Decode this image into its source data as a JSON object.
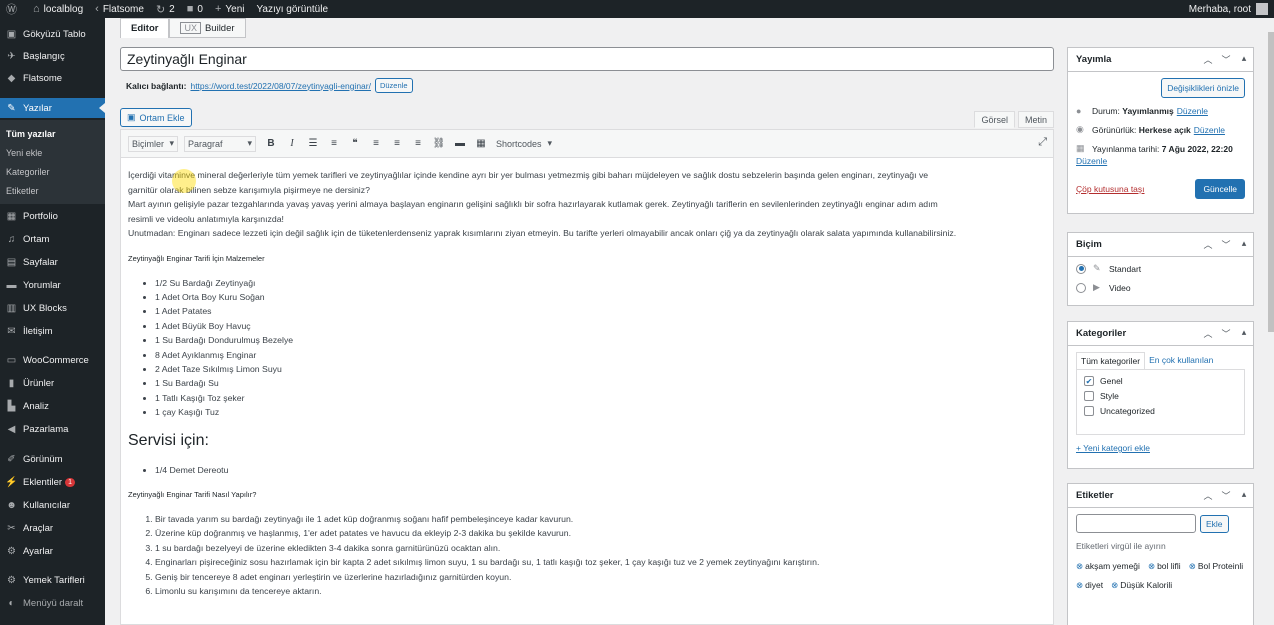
{
  "adminbar": {
    "site": "localblog",
    "theme": "Flatsome",
    "updates": "2",
    "comments": "0",
    "new_label": "Yeni",
    "view_post": "Yazıyı görüntüle",
    "greeting": "Merhaba, root"
  },
  "menu": {
    "items": [
      {
        "label": "Gökyüzü Tablo",
        "icon": "dashboard-icon"
      },
      {
        "label": "Başlangıç",
        "icon": "rocket-icon"
      },
      {
        "label": "Flatsome",
        "icon": "flatsome-icon"
      },
      {
        "label": "Yazılar",
        "icon": "pin-icon"
      },
      {
        "label": "Portfolio",
        "icon": "portfolio-icon"
      },
      {
        "label": "Ortam",
        "icon": "media-icon"
      },
      {
        "label": "Sayfalar",
        "icon": "pages-icon"
      },
      {
        "label": "Yorumlar",
        "icon": "comments-icon"
      },
      {
        "label": "UX Blocks",
        "icon": "blocks-icon"
      },
      {
        "label": "İletişim",
        "icon": "mail-icon"
      },
      {
        "label": "WooCommerce",
        "icon": "woo-icon"
      },
      {
        "label": "Ürünler",
        "icon": "products-icon"
      },
      {
        "label": "Analiz",
        "icon": "chart-icon"
      },
      {
        "label": "Pazarlama",
        "icon": "megaphone-icon"
      },
      {
        "label": "Görünüm",
        "icon": "brush-icon"
      },
      {
        "label": "Eklentiler",
        "icon": "plugin-icon"
      },
      {
        "label": "Kullanıcılar",
        "icon": "users-icon"
      },
      {
        "label": "Araçlar",
        "icon": "tools-icon"
      },
      {
        "label": "Ayarlar",
        "icon": "settings-icon"
      },
      {
        "label": "Yemek Tarifleri",
        "icon": "gear-icon"
      },
      {
        "label": "Menüyü daralt",
        "icon": "collapse-icon"
      }
    ],
    "submenu": [
      "Tüm yazılar",
      "Yeni ekle",
      "Kategoriler",
      "Etiketler"
    ],
    "plugins_badge": "1"
  },
  "editor": {
    "tab_editor": "Editor",
    "tab_ux": "UX",
    "tab_builder": "Builder",
    "title": "Zeytinyağlı Enginar",
    "permalink_label": "Kalıcı bağlantı:",
    "permalink_url": "https://word.test/2022/08/07/zeytinyagli-enginar/",
    "edit_label": "Düzenle",
    "media_button": "Ortam Ekle",
    "visual_tab": "Görsel",
    "text_tab": "Metin",
    "formats": "Biçimler",
    "paragraph": "Paragraf",
    "shortcodes": "Shortcodes"
  },
  "content": {
    "p1_line1": "İçerdiği vitaminve mineral değerleriyle tüm yemek tarifleri ve zeytinyağlılar içinde kendine ayrı bir yer bulması yetmezmiş gibi baharı müjdeleyen ve sağlık dostu sebzelerin başında gelen enginarı, zeytinyağı ve",
    "p1_line2": "garnitür olarak bilinen sebze karışımıyla pişirmeye ne dersiniz?",
    "p2_line1": "Mart ayının gelişiyle pazar tezgahlarında yavaş yavaş yerini almaya başlayan enginarın gelişini sağlıklı bir sofra hazırlayarak kutlamak gerek. Zeytinyağlı tariflerin en sevilenlerinden zeytinyağlı enginar adım adım",
    "p2_line2": "resimli ve videolu anlatımıyla karşınızda!",
    "p3": "Unutmadan: Enginarı sadece lezzeti için değil sağlık için de tüketenlerdenseniz yaprak kısımlarını ziyan etmeyin. Bu tarifte yerleri olmayabilir ancak onları çiğ ya da zeytinyağlı olarak salata yapımında kullanabilirsiniz.",
    "ingredients_heading": "Zeytinyağlı Enginar Tarifi İçin Malzemeler",
    "ingredients": [
      "1/2 Su Bardağı Zeytinyağı",
      "1 Adet Orta Boy Kuru Soğan",
      "1 Adet Patates",
      "1 Adet Büyük Boy Havuç",
      "1 Su Bardağı Dondurulmuş Bezelye",
      "8 Adet Ayıklanmış Enginar",
      "2 Adet Taze Sıkılmış Limon Suyu",
      "1 Su Bardağı Su",
      "1 Tatlı Kaşığı Toz şeker",
      "1 çay Kaşığı Tuz"
    ],
    "serving_heading": "Servisi için:",
    "serving": [
      "1/4 Demet Dereotu"
    ],
    "steps_heading": "Zeytinyağlı Enginar Tarifi Nasıl Yapılır?",
    "steps": [
      "Bir tavada yarım su bardağı zeytinyağı ile 1 adet küp doğranmış soğanı hafif pembeleşinceye kadar kavurun.",
      "Üzerine küp doğranmış ve haşlanmış, 1'er adet patates ve havucu da ekleyip 2-3 dakika bu şekilde kavurun.",
      "1 su bardağı bezelyeyi de üzerine ekledikten 3-4 dakika sonra garnitürünüzü ocaktan alın.",
      "Enginarları pişireceğiniz sosu hazırlamak için bir kapta 2 adet sıkılmış limon suyu, 1 su bardağı su,  1 tatlı kaşığı toz şeker, 1 çay kaşığı tuz ve 2 yemek zeytinyağını karıştırın.",
      "Geniş bir tencereye 8 adet enginarı yerleştirin ve üzerlerine hazırladığınız garnitürden koyun.",
      "Limonlu su karışımını da tencereye aktarın."
    ]
  },
  "publish": {
    "title": "Yayımla",
    "preview": "Değişiklikleri önizle",
    "status_label": "Durum:",
    "status_value": "Yayımlanmış",
    "visibility_label": "Görünürlük:",
    "visibility_value": "Herkese açık",
    "date_label": "Yayınlanma tarihi:",
    "date_value": "7 Ağu 2022, 22:20",
    "edit": "Düzenle",
    "trash": "Çöp kutusuna taşı",
    "update": "Güncelle"
  },
  "format": {
    "title": "Biçim",
    "options": [
      "Standart",
      "Video"
    ],
    "selected": "Standart"
  },
  "categories": {
    "title": "Kategoriler",
    "tab_all": "Tüm kategoriler",
    "tab_popular": "En çok kullanılan",
    "items": [
      {
        "label": "Genel",
        "checked": true
      },
      {
        "label": "Style",
        "checked": false
      },
      {
        "label": "Uncategorized",
        "checked": false
      }
    ],
    "add_new": "+ Yeni kategori ekle"
  },
  "tags": {
    "title": "Etiketler",
    "input_value": "",
    "add": "Ekle",
    "hint": "Etiketleri virgül ile ayırın",
    "items": [
      "akşam yemeği",
      "bol lifli",
      "Bol Proteinli",
      "diyet",
      "Düşük Kalorili"
    ]
  }
}
